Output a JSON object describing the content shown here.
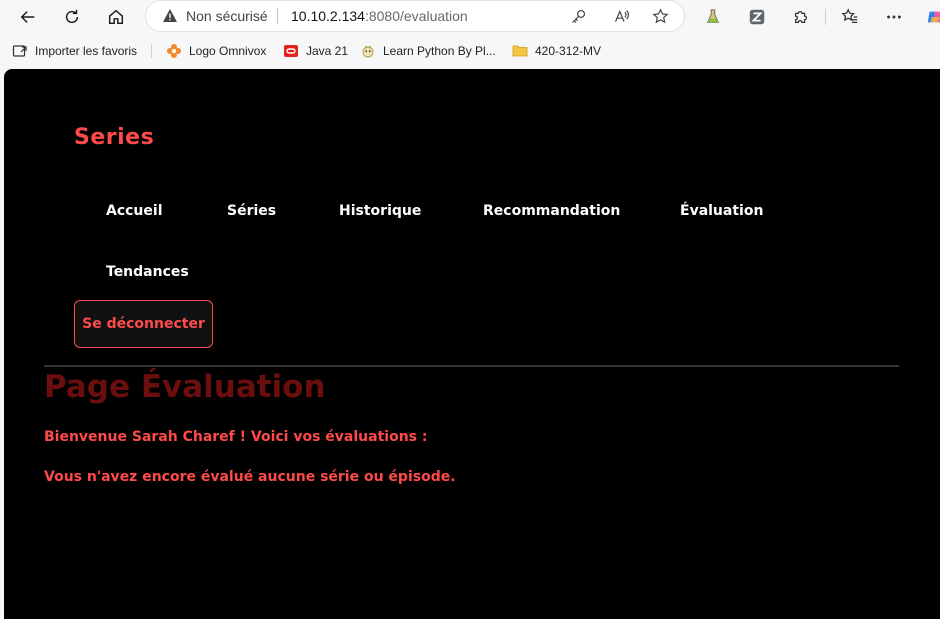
{
  "browser": {
    "security_label": "Non sécurisé",
    "url_host": "10.10.2.134",
    "url_rest": ":8080/evaluation",
    "icons": [
      "back-icon",
      "refresh-icon",
      "home-icon",
      "warning-icon",
      "key-icon",
      "read-aloud-icon",
      "favorite-star-icon",
      "flask-icon",
      "z-extension-icon",
      "extensions-puzzle-icon",
      "favorites-list-icon",
      "more-icon",
      "copilot-icon"
    ],
    "bookmarks": [
      {
        "label": "Importer les favoris"
      },
      {
        "label": "Logo Omnivox"
      },
      {
        "label": "Java 21"
      },
      {
        "label": "Learn Python By Pl..."
      },
      {
        "label": "420-312-MV"
      }
    ]
  },
  "site": {
    "logo": "Series",
    "nav": {
      "accueil": "Accueil",
      "series": "Séries",
      "historique": "Historique",
      "recommandation": "Recommandation",
      "evaluation": "Évaluation",
      "tendances": "Tendances"
    },
    "logout_label": "Se déconnecter",
    "page_title": "Page Évaluation",
    "welcome_text": "Bienvenue Sarah Charef ! Voici vos évaluations :",
    "empty_text": "Vous n'avez encore évalué aucune série ou épisode.",
    "colors": {
      "accent": "#ff4a4a",
      "title": "#6b0e0e",
      "background": "#000000",
      "nav_text": "#ffffff"
    }
  }
}
